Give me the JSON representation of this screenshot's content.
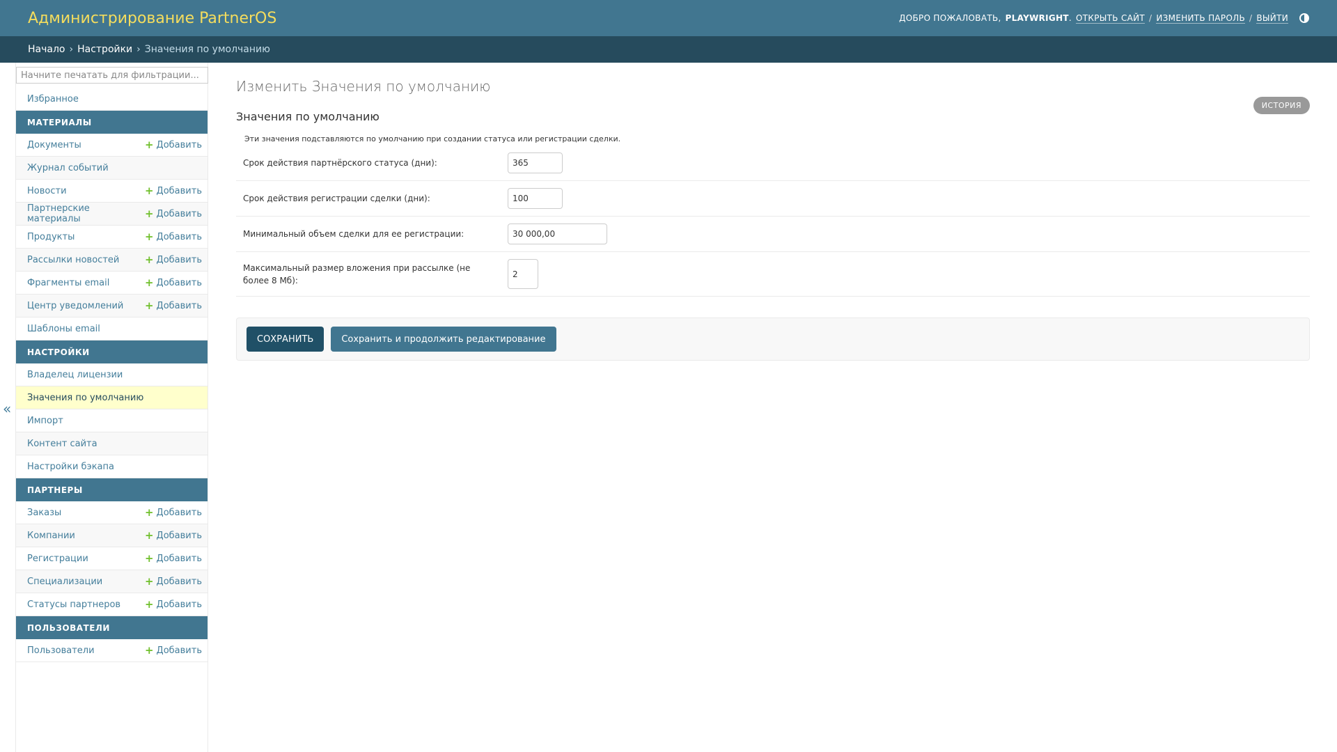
{
  "header": {
    "branding": "Администрирование PartnerOS",
    "welcome": "Добро пожаловать,",
    "username": "playwright",
    "view_site": "Открыть сайт",
    "change_password": "Изменить пароль",
    "logout": "Выйти",
    "separator": "/",
    "period": "."
  },
  "breadcrumbs": {
    "home": "Начало",
    "section": "Настройки",
    "current": "Значения по умолчанию",
    "sep": "›"
  },
  "sidebar": {
    "filter_placeholder": "Начните печатать для фильтрации...",
    "favorites": "Избранное",
    "add_label": "Добавить",
    "collapse_label": "«",
    "modules": [
      {
        "caption": "Материалы",
        "items": [
          {
            "label": "Документы",
            "add": true
          },
          {
            "label": "Журнал событий",
            "add": false
          },
          {
            "label": "Новости",
            "add": true
          },
          {
            "label": "Партнерские материалы",
            "add": true
          },
          {
            "label": "Продукты",
            "add": true
          },
          {
            "label": "Рассылки новостей",
            "add": true
          },
          {
            "label": "Фрагменты email",
            "add": true
          },
          {
            "label": "Центр уведомлений",
            "add": true
          },
          {
            "label": "Шаблоны email",
            "add": false
          }
        ]
      },
      {
        "caption": "Настройки",
        "items": [
          {
            "label": "Владелец лицензии",
            "add": false
          },
          {
            "label": "Значения по умолчанию",
            "add": false,
            "current": true
          },
          {
            "label": "Импорт",
            "add": false
          },
          {
            "label": "Контент сайта",
            "add": false
          },
          {
            "label": "Настройки бэкапа",
            "add": false
          }
        ]
      },
      {
        "caption": "Партнеры",
        "items": [
          {
            "label": "Заказы",
            "add": true
          },
          {
            "label": "Компании",
            "add": true
          },
          {
            "label": "Регистрации",
            "add": true
          },
          {
            "label": "Специализации",
            "add": true
          },
          {
            "label": "Статусы партнеров",
            "add": true
          }
        ]
      },
      {
        "caption": "Пользователи",
        "items": [
          {
            "label": "Пользователи",
            "add": true
          }
        ]
      }
    ]
  },
  "main": {
    "title": "Изменить Значения по умолчанию",
    "history_button": "История",
    "fieldset_title": "Значения по умолчанию",
    "fieldset_description": "Эти значения подставляются по умолчанию при создании статуса или регистрации сделки.",
    "fields": [
      {
        "label": "Срок действия партнёрского статуса (дни):",
        "value": "365"
      },
      {
        "label": "Срок действия регистрации сделки (дни):",
        "value": "100"
      },
      {
        "label": "Минимальный объем сделки для ее регистрации:",
        "value": "30 000,00"
      },
      {
        "label": "Максимальный размер вложения при рассылке (не более 8 Мб):",
        "value": "2"
      }
    ],
    "save_button": "Сохранить",
    "save_continue_button": "Сохранить и продолжить редактирование"
  }
}
